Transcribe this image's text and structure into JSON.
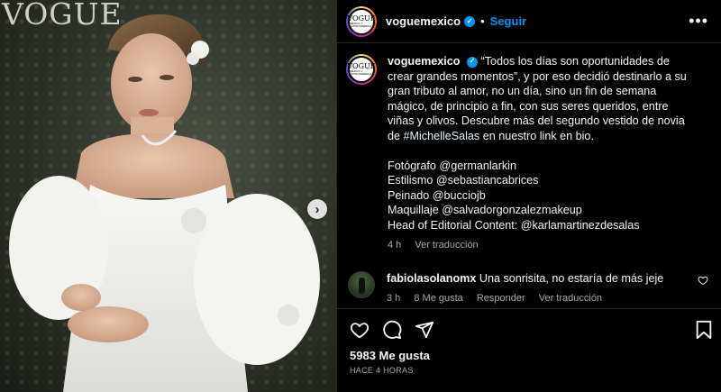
{
  "media": {
    "brand_mark": "VOGUE",
    "next_icon": "›"
  },
  "post": {
    "username": "voguemexico",
    "separator": "•",
    "follow_label": "Seguir",
    "more_icon": "•••",
    "avatar_text": "VOGUE",
    "avatar_subtext": "MÉXICO Y LATINOAMÉRICA",
    "caption": {
      "username": "voguemexico",
      "text_before": "“Todos los días son oportunidades de crear grandes momentos”, y por eso decidió destinarlo a su gran tributo al amor, no un día, sino un fin de semana mágico, de principio a fin, con sus seres queridos, entre viñas y olivos. Descubre más del segundo vestido de novia de ",
      "hashtag": "#MichelleSalas",
      "text_after": " en nuestro link en bio.",
      "credits": "Fotógrafo @germanlarkin\nEstilismo @sebastiancabrices\nPeinado @bucciojb\nMaquillaje @salvadorgonzalezmakeup\nHead of Editorial Content: @karlamartinezdesalas",
      "time": "4 h",
      "translate": "Ver traducción"
    },
    "comment": {
      "username": "fabiolasolanomx",
      "text": "Una sonrisita, no estaría de más jeje",
      "time": "3 h",
      "likes": "8 Me gusta",
      "reply": "Responder",
      "translate": "Ver traducción"
    },
    "likes": "5983 Me gusta",
    "timestamp": "HACE 4 HORAS"
  },
  "colors": {
    "accent": "#0095f6",
    "background": "#000000",
    "muted_text": "#a8a8a8"
  },
  "icons": [
    "heart-icon",
    "comment-icon",
    "share-icon",
    "bookmark-icon",
    "verified-icon",
    "more-icon",
    "chevron-right-icon"
  ]
}
